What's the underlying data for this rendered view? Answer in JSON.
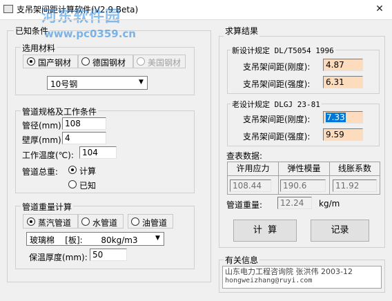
{
  "window": {
    "title": "支吊架间距计算软件(V2.9 Beta)",
    "close_glyph": "✕",
    "watermark_logo": "河东软件园",
    "watermark_url": "www.pc0359.cn"
  },
  "known_conditions": {
    "group_label": "已知条件",
    "material": {
      "group_label": "选用材料",
      "options": [
        "国产钢材",
        "德国钢材",
        "美国钢材"
      ],
      "selected": "国产钢材",
      "steel_grade": "10号钢"
    },
    "pipe_spec": {
      "group_label": "管道规格及工作条件",
      "diameter_label": "管径(mm):",
      "diameter_value": "108",
      "thickness_label": "壁厚(mm):",
      "thickness_value": "4",
      "temperature_label": "工作温度(℃):",
      "temperature_value": "104",
      "total_weight_label": "管道总重:",
      "weight_options": [
        "计算",
        "已知"
      ],
      "weight_selected": "计算"
    },
    "pipe_weight_calc": {
      "group_label": "管道重量计算",
      "types": [
        "蒸汽管道",
        "水管道",
        "油管道"
      ],
      "type_selected": "蒸汽管道",
      "insulation_material": "玻璃棉    [板]:       80kg/m3",
      "insulation_thickness_label": "保温厚度(mm):",
      "insulation_thickness_value": "50"
    }
  },
  "results": {
    "group_label": "求算结果",
    "new_standard": {
      "group_label": "新设计规定  DL/T5054 1996",
      "rigidity_label": "支吊架间距(刚度):",
      "rigidity_value": "4.87",
      "strength_label": "支吊架间距(强度):",
      "strength_value": "6.31"
    },
    "old_standard": {
      "group_label": "老设计规定 DLGJ 23-81",
      "rigidity_label": "支吊架间距(刚度):",
      "rigidity_value": "7.33",
      "strength_label": "支吊架间距(强度):",
      "strength_value": "9.59"
    },
    "lookup": {
      "label": "查表数据:",
      "headers": [
        "许用应力",
        "弹性模量",
        "线胀系数"
      ],
      "values": [
        "108.44",
        "190.6",
        "11.92"
      ]
    },
    "pipe_weight": {
      "label": "管道重量:",
      "value": "12.24",
      "unit": "kg/m"
    },
    "calc_button": "计  算",
    "record_button": "记录"
  },
  "about": {
    "group_label": "有关信息",
    "line1": "山东电力工程咨询院 张洪伟  2003-12",
    "line2": "hongweizhang@ruyi.com"
  },
  "colors": {
    "result_field_bg": "#fddcbd",
    "selection_bg": "#0078d7",
    "watermark": "#2e8be0"
  }
}
